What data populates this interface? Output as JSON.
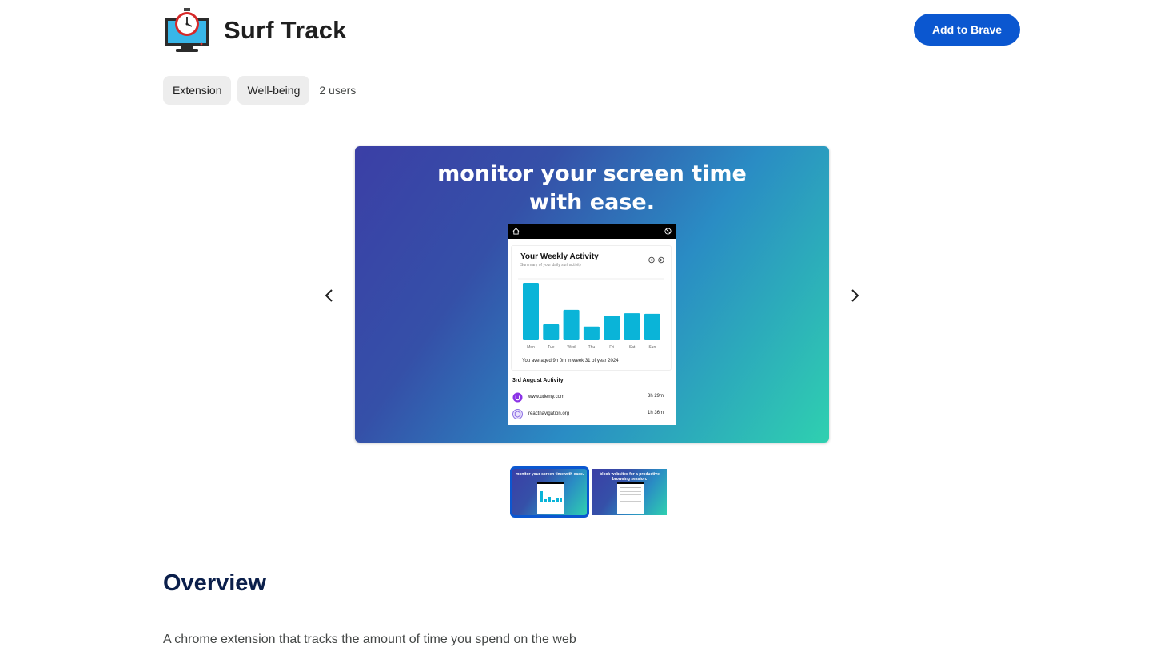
{
  "app": {
    "title": "Surf Track",
    "icon": "monitor-stopwatch-icon",
    "add_button": "Add to Brave",
    "chips": [
      "Extension",
      "Well-being"
    ],
    "users": "2 users"
  },
  "gallery": {
    "prev_icon": "chevron-left-icon",
    "next_icon": "chevron-right-icon",
    "main": {
      "headline_line1": "monitor your screen time",
      "headline_line2": "with ease.",
      "mock": {
        "card_title": "Your Weekly Activity",
        "card_subtitle": "Summary of your daily surf activity",
        "days": [
          "Mon",
          "Tue",
          "Wed",
          "Thu",
          "Fri",
          "Sat",
          "Sun"
        ],
        "values": [
          1.0,
          0.28,
          0.53,
          0.24,
          0.43,
          0.47,
          0.46
        ],
        "average_text": "You averaged 9h 0m in week 31 of year 2024",
        "section_title": "3rd August Activity",
        "sites": [
          {
            "name": "www.udemy.com",
            "time": "3h 29m",
            "icon": "udemy-icon",
            "color": "#8b33e6"
          },
          {
            "name": "reactnavigation.org",
            "time": "1h 36m",
            "icon": "react-navigation-icon",
            "color": "#8d6fe6"
          }
        ]
      }
    },
    "thumbs": [
      {
        "text": "monitor your screen time with ease.",
        "active": true
      },
      {
        "text": "block websites for a productive browsing session.",
        "active": false
      }
    ]
  },
  "overview": {
    "title": "Overview",
    "description": "A chrome extension that tracks the amount of time you spend on the web"
  },
  "colors": {
    "accent": "#0b57d0",
    "bar": "#0ab4d8",
    "heading": "#0b1f4b"
  }
}
